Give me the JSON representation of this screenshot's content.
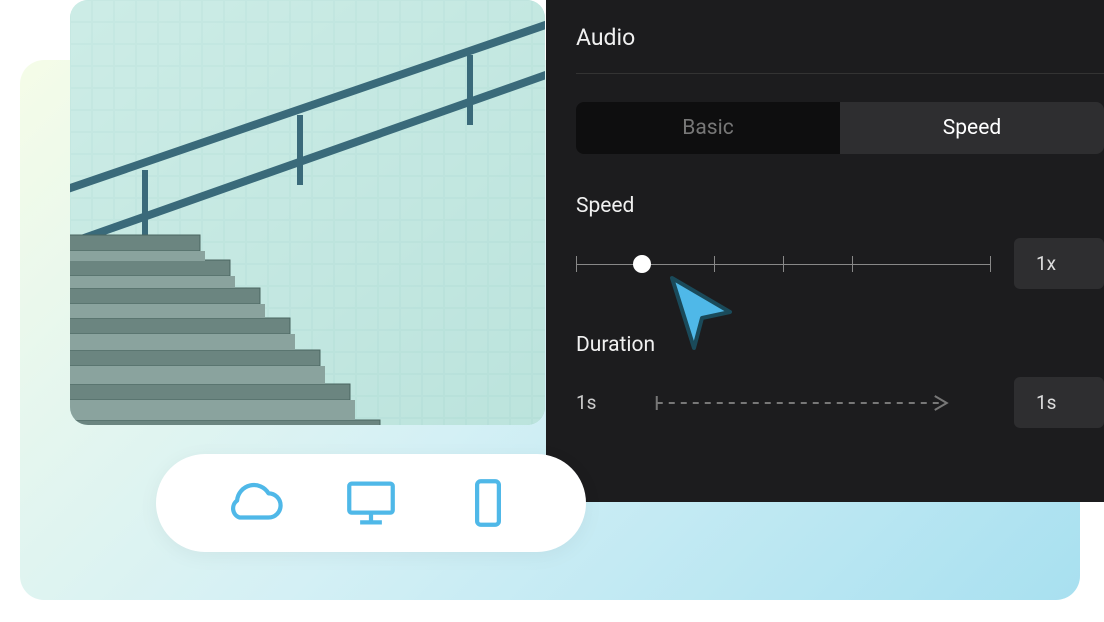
{
  "panel": {
    "title": "Audio",
    "tabs": {
      "basic": "Basic",
      "speed": "Speed"
    },
    "speed": {
      "label": "Speed",
      "value": "1x",
      "slider_position_percent": 16
    },
    "duration": {
      "label": "Duration",
      "start": "1s",
      "end": "1s"
    }
  },
  "icons": {
    "cloud": "cloud-icon",
    "desktop": "desktop-icon",
    "mobile": "mobile-icon"
  }
}
